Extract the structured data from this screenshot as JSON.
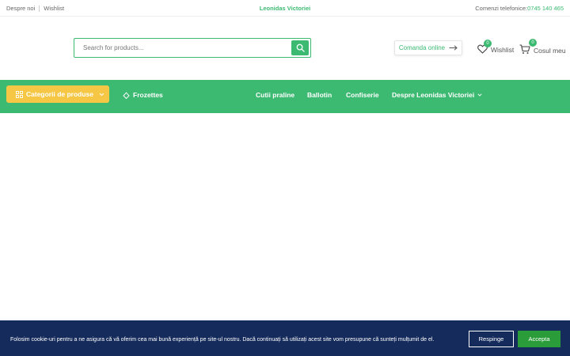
{
  "topbar": {
    "about": "Despre noi",
    "wishlist": "Wishlist",
    "brand": "Leonidas Victoriei",
    "phone_label": "Comenzi telefonice:",
    "phone_number": "0745 140 465"
  },
  "header": {
    "search_placeholder": "Search for products...",
    "order_button": "Comanda online",
    "wishlist_label": "Wishlist",
    "wishlist_count": "0",
    "cart_label": "Cosul meu",
    "cart_count": "0"
  },
  "nav": {
    "categories": "Categorii de produse",
    "items": [
      "Frozettes",
      "Cutii praline",
      "Ballotin",
      "Confiserie",
      "Despre Leonidas Victoriei"
    ]
  },
  "cookie": {
    "message": "Folosim cookie-uri pentru a ne asigura că vă oferim cea mai bună experiență pe site-ul nostru. Dacă continuați să utilizați acest site vom presupune că sunteți mulțumit de el.",
    "reject": "Respinge",
    "accept": "Accepta"
  },
  "colors": {
    "accent": "#3dba72",
    "yellow": "#f6c745",
    "cookie_bg": "#152b5c",
    "accept_bg": "#2a9d3a"
  }
}
